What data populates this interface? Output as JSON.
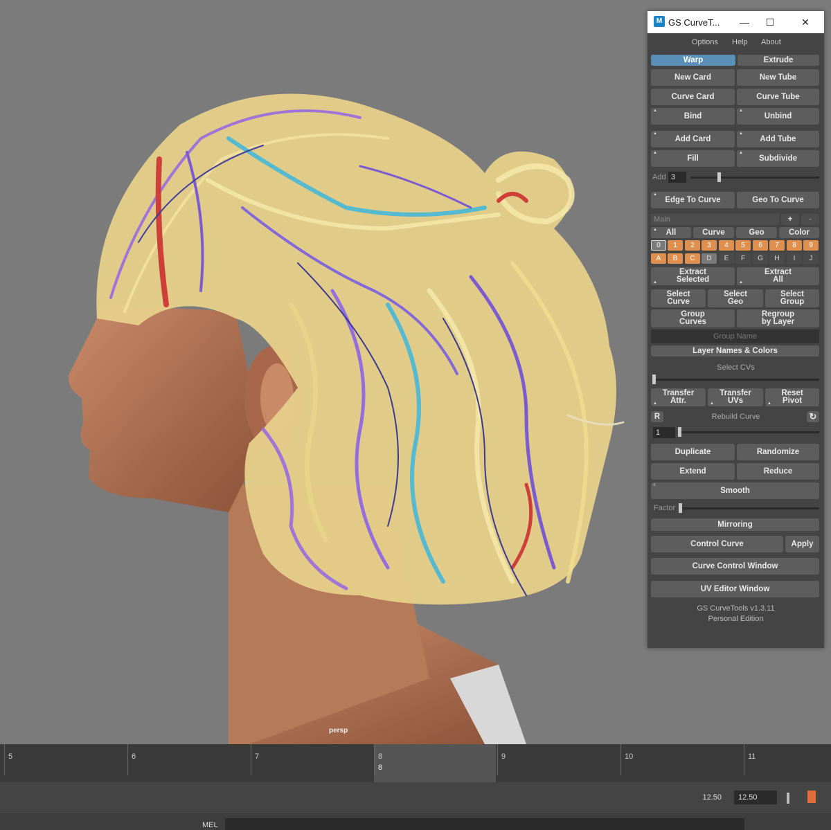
{
  "viewport": {
    "camera": "persp"
  },
  "window": {
    "title": "GS CurveT...",
    "app_icon": "M",
    "controls": {
      "minimize": "—",
      "maximize": "☐",
      "close": "✕"
    },
    "menu": [
      "Options",
      "Help",
      "About"
    ]
  },
  "panel": {
    "warp": "Warp",
    "extrude": "Extrude",
    "new_card": "New Card",
    "new_tube": "New Tube",
    "curve_card": "Curve Card",
    "curve_tube": "Curve Tube",
    "bind": "Bind",
    "unbind": "Unbind",
    "add_card": "Add Card",
    "add_tube": "Add Tube",
    "fill": "Fill",
    "subdivide": "Subdivide",
    "add_label": "Add",
    "add_value": "3",
    "edge_to_curve": "Edge To Curve",
    "geo_to_curve": "Geo To Curve",
    "layer_collection": "Main",
    "plus": "+",
    "minus": "-",
    "filter_all": "All",
    "filter_curve": "Curve",
    "filter_geo": "Geo",
    "filter_color": "Color",
    "layers_numbers": [
      "0",
      "1",
      "2",
      "3",
      "4",
      "5",
      "6",
      "7",
      "8",
      "9"
    ],
    "layers_letters": [
      "A",
      "B",
      "C",
      "D",
      "E",
      "F",
      "G",
      "H",
      "I",
      "J"
    ],
    "extract_selected": "Extract\nSelected",
    "extract_all": "Extract\nAll",
    "select_curve": "Select\nCurve",
    "select_geo": "Select\nGeo",
    "select_group": "Select\nGroup",
    "group_curves": "Group\nCurves",
    "regroup_by_layer": "Regroup\nby Layer",
    "group_name_placeholder": "Group Name",
    "layer_names_colors": "Layer Names & Colors",
    "select_cvs": "Select CVs",
    "transfer_attr": "Transfer\nAttr.",
    "transfer_uvs": "Transfer\nUVs",
    "reset_pivot": "Reset\nPivot",
    "r_button": "R",
    "rebuild_curve": "Rebuild Curve",
    "refresh_icon": "↻",
    "rebuild_value": "1",
    "duplicate": "Duplicate",
    "randomize": "Randomize",
    "extend": "Extend",
    "reduce": "Reduce",
    "smooth": "Smooth",
    "factor_label": "Factor",
    "mirroring": "Mirroring",
    "control_curve": "Control Curve",
    "apply": "Apply",
    "curve_control_window": "Curve Control Window",
    "uv_editor_window": "UV Editor Window",
    "version": "GS CurveTools v1.3.11",
    "edition": "Personal Edition"
  },
  "timeline": {
    "frames": [
      "5",
      "6",
      "7",
      "8",
      "9",
      "10",
      "11"
    ],
    "current_frame": "8",
    "range_end": "12.50",
    "range_end_2": "12.50"
  },
  "command_line": {
    "mode": "MEL"
  },
  "colors": {
    "accent_active": "#5a8fb8",
    "layer_orange": "#e0904e",
    "panel_bg": "#444444",
    "viewport_bg": "#7b7b7b"
  }
}
